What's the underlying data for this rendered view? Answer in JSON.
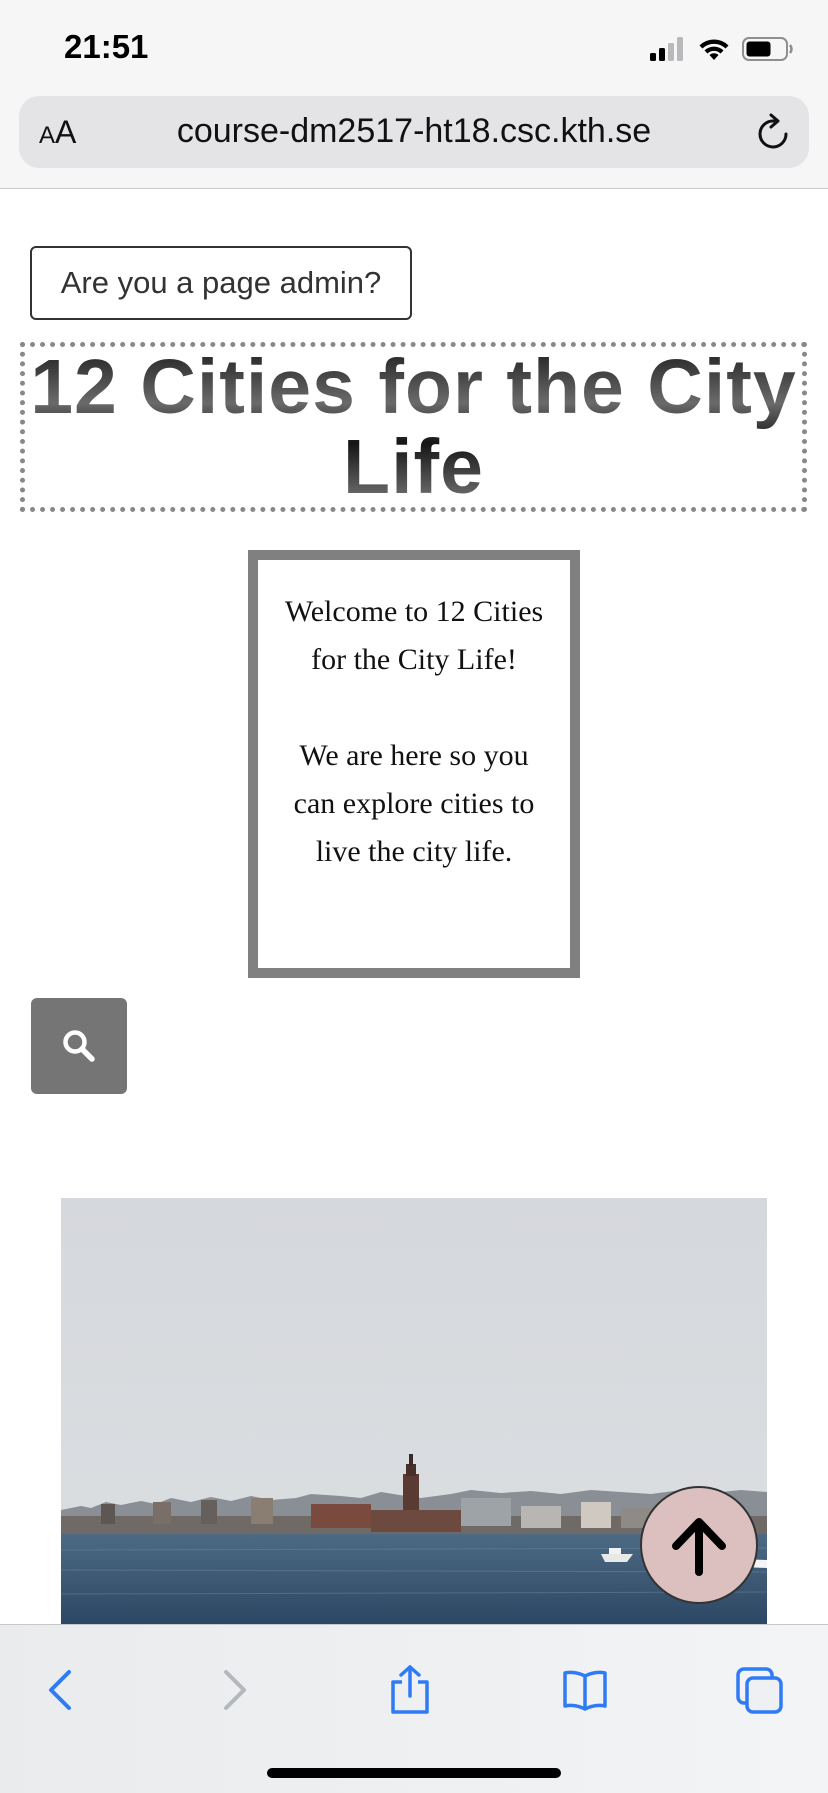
{
  "status_bar": {
    "time": "21:51",
    "icons": [
      "cellular-signal-icon",
      "wifi-icon",
      "battery-icon"
    ]
  },
  "browser": {
    "text_size_label_small": "A",
    "text_size_label_large": "A",
    "url": "course-dm2517-ht18.csc.kth.se",
    "toolbar_icons": [
      "back-icon",
      "forward-icon",
      "share-icon",
      "bookmarks-icon",
      "tabs-icon"
    ]
  },
  "page": {
    "admin_button_label": "Are you a page admin?",
    "title": "12 Cities for the City Life",
    "welcome_line1": "Welcome to 12 Cities for the City Life!",
    "welcome_line2": "We are here so you can explore cities to live the city life.",
    "search_icon": "search-icon",
    "hero_image": "stockholm-city-hall-skyline",
    "scroll_top_icon": "arrow-up-icon"
  },
  "colors": {
    "accent_blue": "#2f7bf5",
    "search_button": "#757575",
    "scroll_top_bg": "#dcbfbf",
    "welcome_border": "#808080"
  }
}
